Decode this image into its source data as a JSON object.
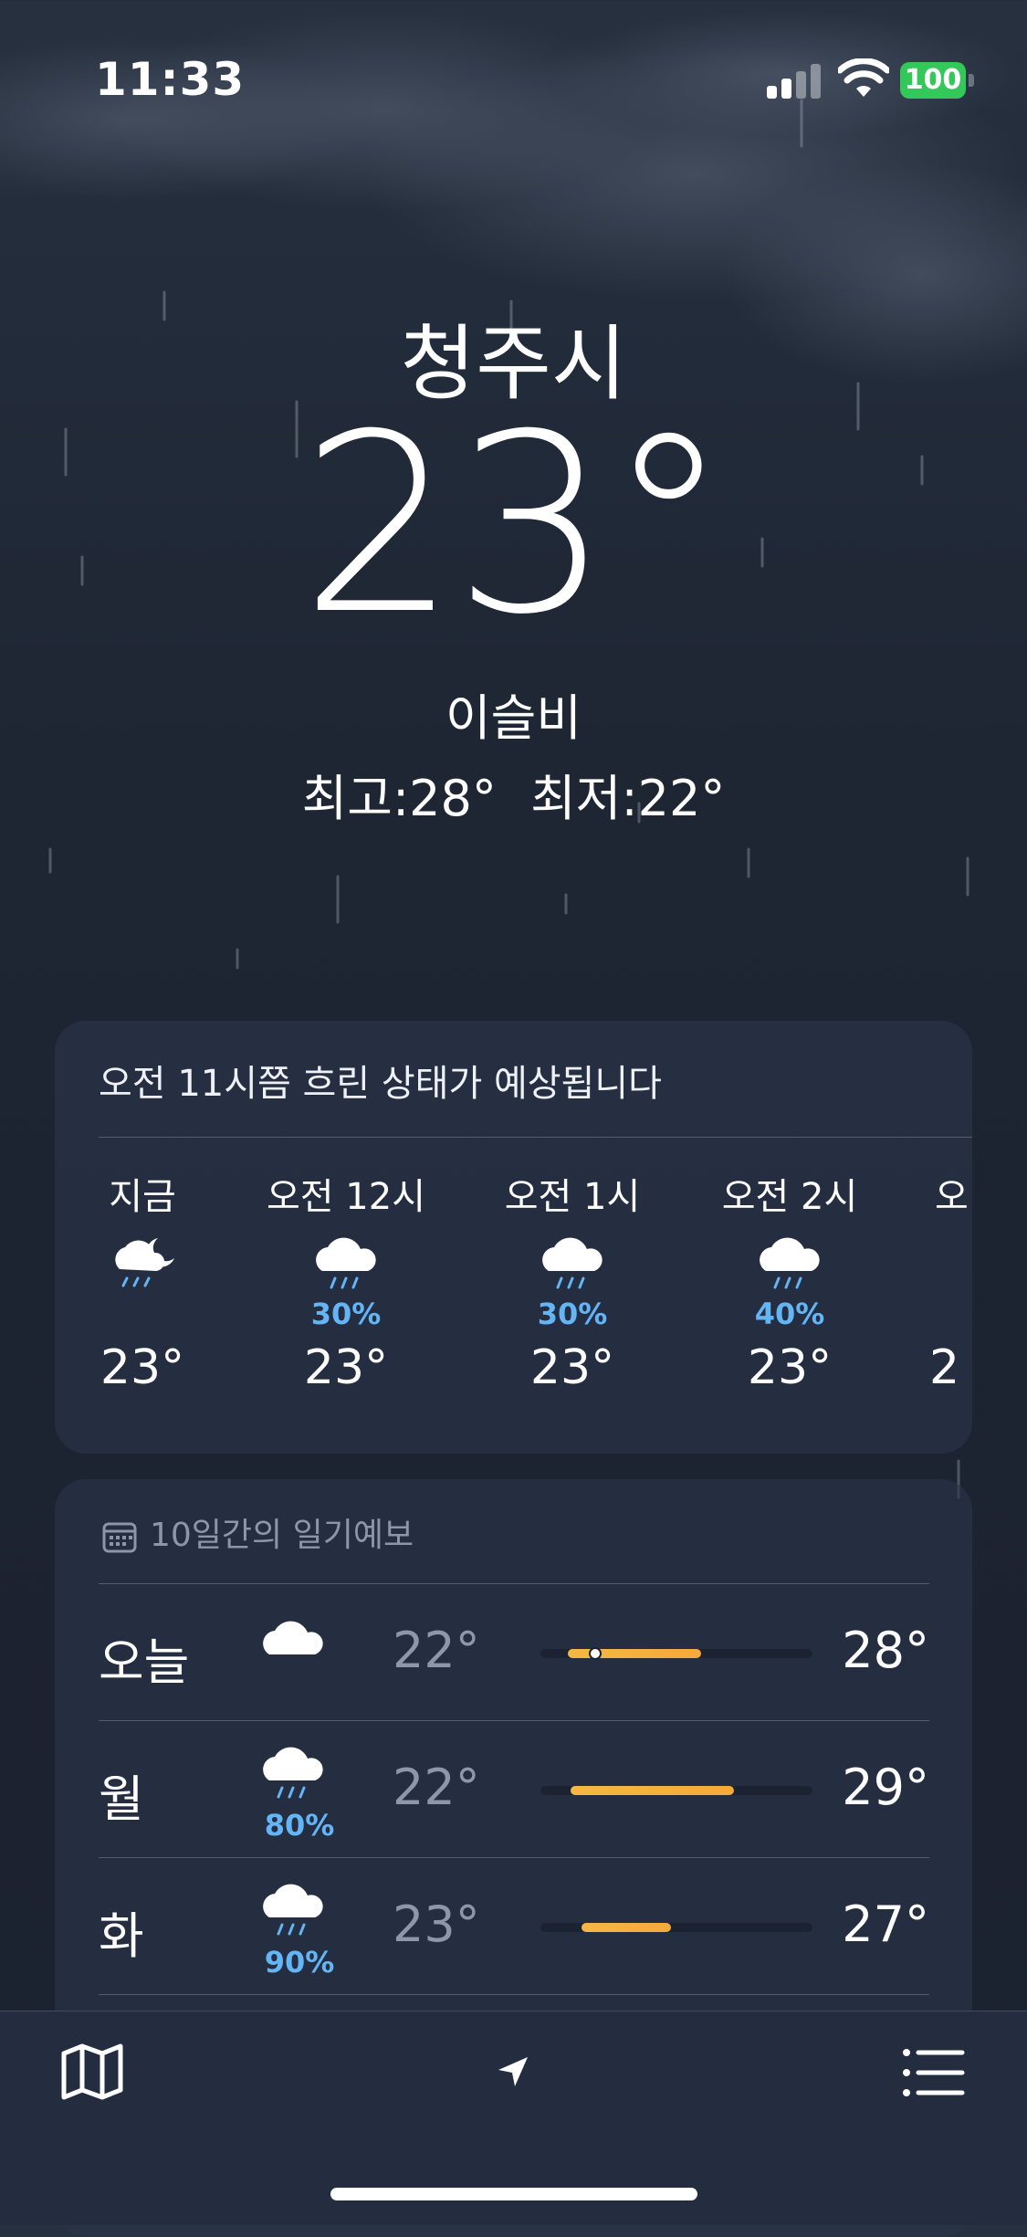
{
  "status": {
    "time": "11:33",
    "battery": "100"
  },
  "location": {
    "city": "청주시",
    "temperature": "23°",
    "condition": "이슬비",
    "high": "최고:28°",
    "low": "최저:22°"
  },
  "hourly": {
    "summary": "오전 11시쯤 흐린 상태가 예상됩니다",
    "items": [
      {
        "label": "지금",
        "icon": "cloud-moon-rain-icon",
        "precip": "",
        "temp": "23°"
      },
      {
        "label": "오전 12시",
        "icon": "cloud-rain-icon",
        "precip": "30%",
        "temp": "23°"
      },
      {
        "label": "오전 1시",
        "icon": "cloud-rain-icon",
        "precip": "30%",
        "temp": "23°"
      },
      {
        "label": "오전 2시",
        "icon": "cloud-rain-icon",
        "precip": "40%",
        "temp": "23°"
      },
      {
        "label": "오",
        "icon": "",
        "precip": "",
        "temp": "2"
      }
    ]
  },
  "forecast": {
    "title": "10일간의 일기예보",
    "days": [
      {
        "day": "오늘",
        "icon": "cloud-icon",
        "precip": "",
        "low": "22°",
        "high": "28°",
        "bar_start": 0.1,
        "bar_end": 0.59,
        "current": 0.2
      },
      {
        "day": "월",
        "icon": "cloud-rain-icon",
        "precip": "80%",
        "low": "22°",
        "high": "29°",
        "bar_start": 0.11,
        "bar_end": 0.71,
        "current": null
      },
      {
        "day": "화",
        "icon": "cloud-rain-icon",
        "precip": "90%",
        "low": "23°",
        "high": "27°",
        "bar_start": 0.15,
        "bar_end": 0.48,
        "current": null
      }
    ]
  },
  "colors": {
    "accent_precip": "#64b5f6",
    "temp_bar": "#f4b942",
    "battery": "#34c759"
  },
  "tabbar": {
    "left_icon": "map-icon",
    "center_icon": "location-arrow-icon",
    "right_icon": "list-icon"
  }
}
